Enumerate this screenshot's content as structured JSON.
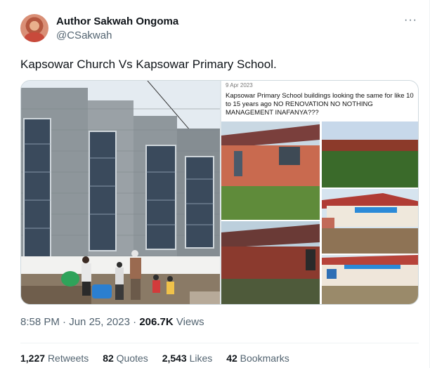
{
  "author": {
    "name": "Author Sakwah Ongoma",
    "handle": "@CSakwah"
  },
  "more_label": "···",
  "tweet_text": "Kapsowar Church Vs Kapsowar Primary School.",
  "embedded_post": {
    "date": "9 Apr 2023",
    "text": "Kapsowar Primary School buildings looking the same for like 10 to 15 years ago NO RENOVATION NO NOTHING MANAGEMENT INAFANYA???"
  },
  "meta": {
    "time": "8:58 PM",
    "dot": "·",
    "date": "Jun 25, 2023",
    "dot2": "·",
    "views_count": "206.7K",
    "views_label": "Views"
  },
  "stats": {
    "retweets": {
      "count": "1,227",
      "label": "Retweets"
    },
    "quotes": {
      "count": "82",
      "label": "Quotes"
    },
    "likes": {
      "count": "2,543",
      "label": "Likes"
    },
    "bookmarks": {
      "count": "42",
      "label": "Bookmarks"
    }
  }
}
